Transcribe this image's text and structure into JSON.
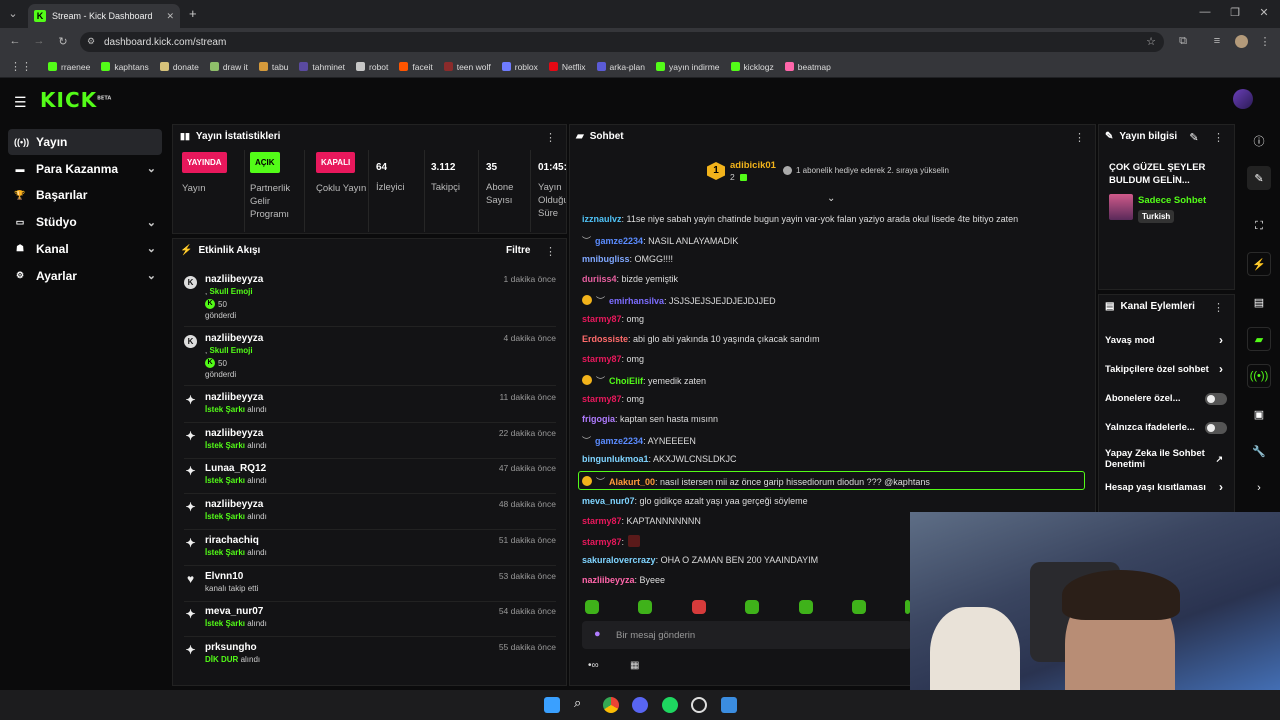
{
  "browser": {
    "tab_title": "Stream - Kick Dashboard",
    "new_tab": "+",
    "url": "dashboard.kick.com/stream",
    "bookmarks": [
      {
        "label": "rraenee",
        "color": "#53fc18"
      },
      {
        "label": "kaphtans",
        "color": "#53fc18"
      },
      {
        "label": "donate",
        "color": "#d6c27a"
      },
      {
        "label": "draw it",
        "color": "#8fbf6a"
      },
      {
        "label": "tabu",
        "color": "#d59a3b"
      },
      {
        "label": "tahminet",
        "color": "#5a4aa0"
      },
      {
        "label": "robot",
        "color": "#c7c7c7"
      },
      {
        "label": "faceit",
        "color": "#ff5500"
      },
      {
        "label": "teen wolf",
        "color": "#8b2b2b"
      },
      {
        "label": "roblox",
        "color": "#6f7cff"
      },
      {
        "label": "Netflix",
        "color": "#e50914"
      },
      {
        "label": "arka-plan",
        "color": "#5b5bd6"
      },
      {
        "label": "yayın indirme",
        "color": "#53fc18"
      },
      {
        "label": "kicklogz",
        "color": "#53fc18"
      },
      {
        "label": "beatmap",
        "color": "#ff66aa"
      }
    ]
  },
  "app": {
    "logo": "KICK",
    "logo_sup": "BETA"
  },
  "sidebar": {
    "items": [
      {
        "label": "Yayın",
        "icon": "broadcast-icon"
      },
      {
        "label": "Para Kazanma",
        "icon": "money-icon"
      },
      {
        "label": "Başarılar",
        "icon": "trophy-icon"
      },
      {
        "label": "Stüdyo",
        "icon": "studio-icon"
      },
      {
        "label": "Kanal",
        "icon": "channel-icon"
      },
      {
        "label": "Ayarlar",
        "icon": "gear-icon"
      }
    ]
  },
  "stats": {
    "title": "Yayın İstatistikleri",
    "badges": [
      {
        "badge": "YAYINDA",
        "label": "Yayın",
        "color": "#e8185c"
      },
      {
        "badge": "AÇIK",
        "label": "Partnerlik Gelir Programı",
        "color": "#53fc18"
      },
      {
        "badge": "KAPALI",
        "label": "Çoklu Yayın",
        "color": "#e8185c"
      }
    ],
    "numbers": [
      {
        "value": "64",
        "label": "İzleyici"
      },
      {
        "value": "3.112",
        "label": "Takipçi"
      },
      {
        "value": "35",
        "label": "Abone Sayısı"
      },
      {
        "value": "01:45:",
        "label": "Yayın Olduğu Süre"
      }
    ]
  },
  "activity": {
    "title": "Etkinlik Akışı",
    "filter": "Filtre",
    "events": [
      {
        "user": "nazliibeyyza",
        "time": "1 dakika önce",
        "l2_pre": ", ",
        "l2_b": "Skull Emoji",
        "l2_post": "",
        "amount": "50",
        "l3": "gönderdi",
        "type": "kicks"
      },
      {
        "user": "nazliibeyyza",
        "time": "4 dakika önce",
        "l2_pre": ", ",
        "l2_b": "Skull Emoji",
        "l2_post": "",
        "amount": "50",
        "l3": "gönderdi",
        "type": "kicks"
      },
      {
        "user": "nazliibeyyza",
        "time": "11 dakika önce",
        "l2_pre": "",
        "l2_b": "İstek Şarkı",
        "l2_post": " alındı",
        "type": "reward"
      },
      {
        "user": "nazliibeyyza",
        "time": "22 dakika önce",
        "l2_pre": "",
        "l2_b": "İstek Şarkı",
        "l2_post": " alındı",
        "type": "reward"
      },
      {
        "user": "Lunaa_RQ12",
        "time": "47 dakika önce",
        "l2_pre": "",
        "l2_b": "İstek Şarkı",
        "l2_post": " alındı",
        "type": "reward"
      },
      {
        "user": "nazliibeyyza",
        "time": "48 dakika önce",
        "l2_pre": "",
        "l2_b": "İstek Şarkı",
        "l2_post": " alındı",
        "type": "reward"
      },
      {
        "user": "rirachachiq",
        "time": "51 dakika önce",
        "l2_pre": "",
        "l2_b": "İstek Şarkı",
        "l2_post": " alındı",
        "type": "reward"
      },
      {
        "user": "Elvnn10",
        "time": "53 dakika önce",
        "l2_pre": "kanalı takip etti",
        "l2_b": "",
        "l2_post": "",
        "type": "follow"
      },
      {
        "user": "meva_nur07",
        "time": "54 dakika önce",
        "l2_pre": "",
        "l2_b": "İstek Şarkı",
        "l2_post": " alındı",
        "type": "reward"
      },
      {
        "user": "prksungho",
        "time": "55 dakika önce",
        "l2_pre": "",
        "l2_b": "DİK DUR",
        "l2_post": " alındı",
        "type": "reward"
      }
    ]
  },
  "chat": {
    "title": "Sohbet",
    "pinned_user": "adibicik01",
    "pinned_count": "2",
    "pinned_msg": "1 abonelik hediye ederek 2. sıraya yükselin",
    "messages": [
      {
        "user": "izznaulvz",
        "color": "#4fc3f7",
        "text": ": 11se niye sabah yayin chatinde bugun yayin var-yok falan yaziyo arada okul lisede 4te bitiyo zaten"
      },
      {
        "user": "gamze2234",
        "color": "#5b8cff",
        "text": ": NASIL ANLAYAMADIK"
      },
      {
        "user": "mnibugliss",
        "color": "#7fa7ff",
        "text": ": OMGG!!!!"
      },
      {
        "user": "duriiss4",
        "color": "#e85fa0",
        "text": ": bizde yemiştik"
      },
      {
        "user": "emirhansilva",
        "color": "#7c6cff",
        "text": ": JSJSJEJSJEJDJEJDJJED"
      },
      {
        "user": "starmy87",
        "color": "#e8185c",
        "text": ": omg"
      },
      {
        "user": "Erdossiste",
        "color": "#ff6b6b",
        "text": ": abi glo abi yakında 10 yaşında çıkacak sandım"
      },
      {
        "user": "starmy87",
        "color": "#e8185c",
        "text": ": omg"
      },
      {
        "user": "ChoiElif",
        "color": "#53fc18",
        "text": ": yemedik zaten"
      },
      {
        "user": "starmy87",
        "color": "#e8185c",
        "text": ": omg"
      },
      {
        "user": "frigogia",
        "color": "#b07cff",
        "text": ": kaptan sen hasta mısınn"
      },
      {
        "user": "gamze2234",
        "color": "#5b8cff",
        "text": ": AYNEEEEN"
      },
      {
        "user": "bingunlukmoa1",
        "color": "#7fd4ff",
        "text": ": AKXJWLCNSLDKJC"
      },
      {
        "user": "Alakurt_00",
        "color": "#ff9b3b",
        "text": ": nasıl istersen mii az önce garip hissediorum diodun ??? @kaphtans"
      },
      {
        "user": "meva_nur07",
        "color": "#7fd4ff",
        "text": ": glo gidikçe azalt yaşı yaa gerçeği söyleme"
      },
      {
        "user": "starmy87",
        "color": "#e8185c",
        "text": ": KAPTANNNNNNN"
      },
      {
        "user": "starmy87",
        "color": "#e8185c",
        "text": ":"
      },
      {
        "user": "sakuralovercrazy",
        "color": "#7fd4ff",
        "text": ": OHA O ZAMAN BEN 200 YAAINDAYIM"
      },
      {
        "user": "nazliibeyyza",
        "color": "#ff66aa",
        "text": ": Byeee"
      }
    ],
    "placeholder": "Bir mesaj gönderin"
  },
  "stream_info": {
    "title": "Yayın bilgisi",
    "stream_title": "ÇOK GÜZEL ŞEYLER BULDUM GELİN...",
    "category": "Sadece Sohbet",
    "tag": "Turkish"
  },
  "channel_actions": {
    "title": "Kanal Eylemleri",
    "items": [
      {
        "label": "Yavaş mod",
        "control": "chevron"
      },
      {
        "label": "Takipçilere özel sohbet",
        "control": "chevron"
      },
      {
        "label": "Abonelere özel...",
        "control": "toggle"
      },
      {
        "label": "Yalnızca ifadelerle...",
        "control": "toggle"
      },
      {
        "label": "Yapay Zeka ile Sohbet Denetimi",
        "control": "external"
      },
      {
        "label": "Hesap yaşı kısıtlaması",
        "control": "chevron"
      }
    ]
  }
}
